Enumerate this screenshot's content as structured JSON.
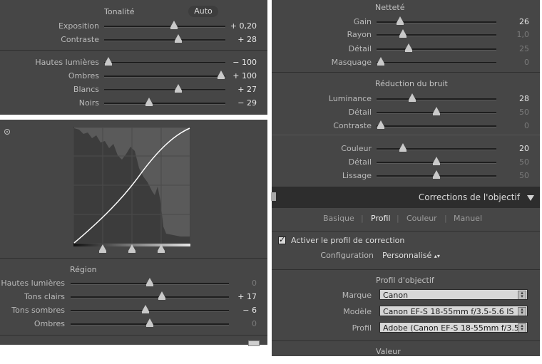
{
  "tonalite": {
    "title": "Tonalité",
    "auto_label": "Auto",
    "rows": [
      {
        "label": "Exposition",
        "value": "+ 0,20",
        "pos": 0.58,
        "dim": false
      },
      {
        "label": "Contraste",
        "value": "+ 28",
        "pos": 0.62,
        "dim": false
      },
      {
        "label": "Hautes lumières",
        "value": "− 100",
        "pos": 0.0,
        "dim": false
      },
      {
        "label": "Ombres",
        "value": "+ 100",
        "pos": 1.0,
        "dim": false
      },
      {
        "label": "Blancs",
        "value": "+ 27",
        "pos": 0.62,
        "dim": false
      },
      {
        "label": "Noirs",
        "value": "− 29",
        "pos": 0.36,
        "dim": false
      }
    ]
  },
  "curve": {
    "region_title": "Région",
    "rows": [
      {
        "label": "Hautes lumières",
        "value": "0",
        "pos": 0.5,
        "dim": true
      },
      {
        "label": "Tons clairs",
        "value": "+ 17",
        "pos": 0.58,
        "dim": false
      },
      {
        "label": "Tons sombres",
        "value": "− 6",
        "pos": 0.47,
        "dim": false
      },
      {
        "label": "Ombres",
        "value": "0",
        "pos": 0.5,
        "dim": true
      }
    ]
  },
  "nettete": {
    "title": "Netteté",
    "rows": [
      {
        "label": "Gain",
        "value": "26",
        "pos": 0.17,
        "dim": false
      },
      {
        "label": "Rayon",
        "value": "1,0",
        "pos": 0.2,
        "dim": true
      },
      {
        "label": "Détail",
        "value": "25",
        "pos": 0.25,
        "dim": true
      },
      {
        "label": "Masquage",
        "value": "0",
        "pos": 0.0,
        "dim": true
      }
    ]
  },
  "bruit": {
    "title": "Réduction du bruit",
    "rows": [
      {
        "label": "Luminance",
        "value": "28",
        "pos": 0.28,
        "dim": false
      },
      {
        "label": "Détail",
        "value": "50",
        "pos": 0.5,
        "dim": true
      },
      {
        "label": "Contraste",
        "value": "0",
        "pos": 0.0,
        "dim": true
      },
      {
        "label": "Couleur",
        "value": "20",
        "pos": 0.2,
        "dim": false
      },
      {
        "label": "Détail",
        "value": "50",
        "pos": 0.5,
        "dim": true
      },
      {
        "label": "Lissage",
        "value": "50",
        "pos": 0.5,
        "dim": true
      }
    ]
  },
  "objectif": {
    "header": "Corrections de l'objectif",
    "tabs": [
      "Basique",
      "Profil",
      "Couleur",
      "Manuel"
    ],
    "active_tab": "Profil",
    "checkbox_label": "Activer le profil de correction",
    "config_label": "Configuration",
    "config_value": "Personnalisé",
    "profile_title": "Profil d'objectif",
    "marque_label": "Marque",
    "marque_value": "Canon",
    "modele_label": "Modèle",
    "modele_value": "Canon EF-S 18-55mm f/3.5-5.6 IS",
    "profil_label": "Profil",
    "profil_value": "Adobe (Canon EF-S 18-55mm f/3.5...",
    "valeur_title": "Valeur"
  }
}
